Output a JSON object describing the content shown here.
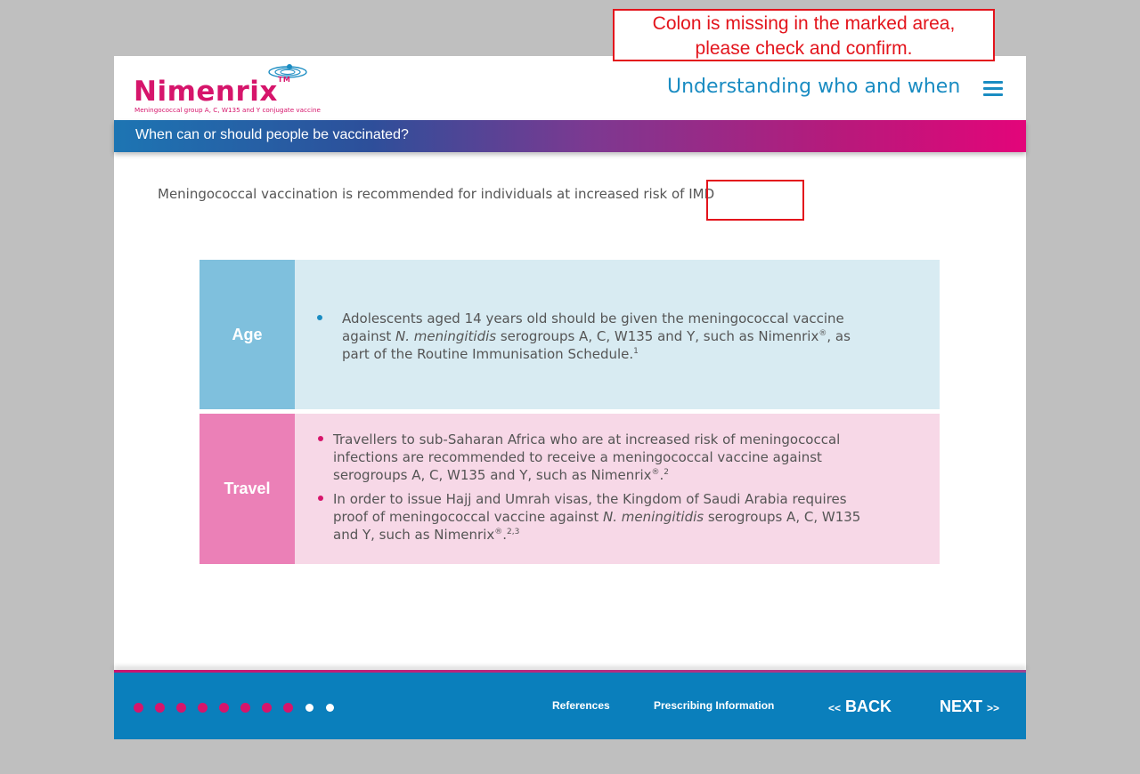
{
  "header": {
    "logo_word": "Nimenrix",
    "logo_tm": "TM",
    "logo_tagline": "Meningococcal group A, C, W135 and Y conjugate vaccine",
    "page_heading": "Understanding who and when",
    "menu_icon": "hamburger-menu-icon"
  },
  "section_band": {
    "title": "When can or should people be vaccinated?"
  },
  "intro": {
    "text": "Meningococcal vaccination is recommended for individuals at increased risk of IMD"
  },
  "rows": [
    {
      "label": "Age",
      "bullets": [
        {
          "parts": [
            "Adolescents aged 14 years old should be given the meningococcal vaccine",
            "against ",
            "N. meningitidis",
            " serogroups A, C, W135 and Y, such as Nimenrix",
            "®",
            ", as",
            "part of the Routine Immunisation Schedule.",
            "1"
          ]
        }
      ]
    },
    {
      "label": "Travel",
      "bullets": [
        {
          "parts": [
            "Travellers to sub-Saharan Africa who are at increased risk of meningococcal",
            "infections are recommended to receive a meningococcal vaccine against",
            "serogroups A, C, W135 and Y, such as Nimenrix",
            "®",
            ".",
            "2"
          ]
        },
        {
          "parts": [
            "In order to issue Hajj and Umrah visas, the Kingdom of Saudi Arabia requires",
            "proof of meningococcal vaccine against ",
            "N. meningitidis",
            " serogroups A, C, W135",
            "and Y, such as Nimenrix",
            "®",
            ".",
            "2,3"
          ]
        }
      ]
    }
  ],
  "footer": {
    "progress": {
      "total": 10,
      "completed": 8
    },
    "references_label": "References",
    "prescribing_label": "Prescribing Information",
    "back_arrows": "<<",
    "back_label": "BACK",
    "next_label": "NEXT",
    "next_arrows": ">>"
  },
  "review_annotation": {
    "text_line1": "Colon is missing in the marked area,",
    "text_line2": "please check and confirm."
  },
  "colors": {
    "brand_pink": "#d6156b",
    "brand_blue": "#1a8cc2",
    "footer_blue": "#0a7fbc",
    "annotation_red": "#e3141c"
  }
}
